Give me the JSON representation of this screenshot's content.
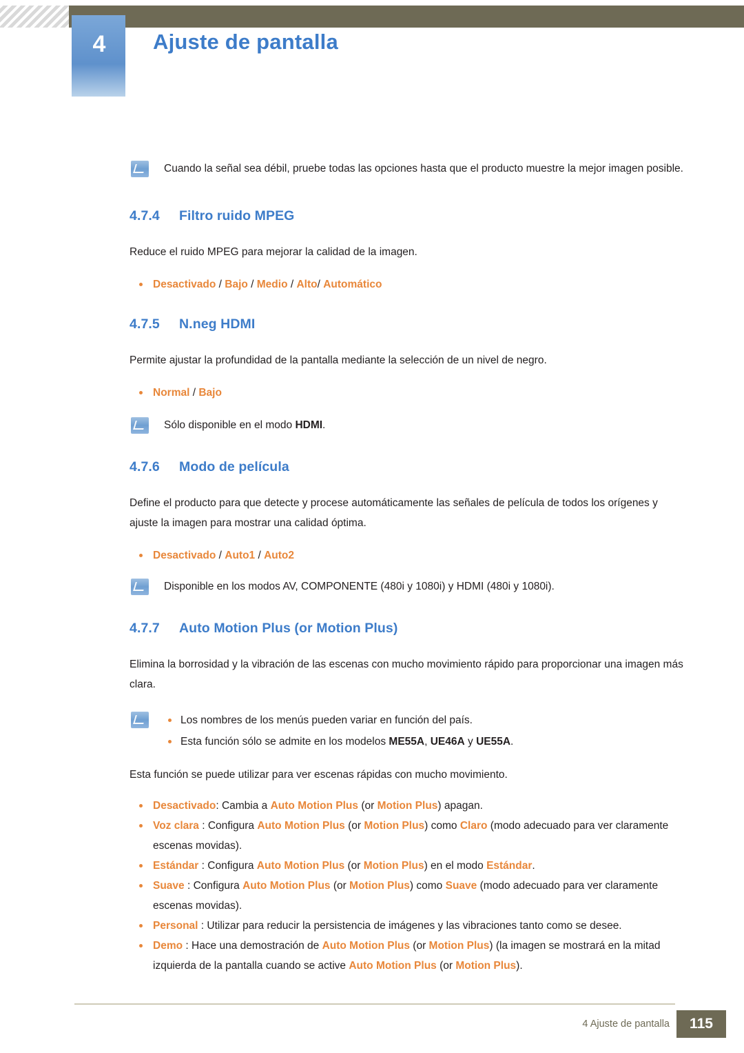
{
  "header": {
    "chapter_number": "4",
    "chapter_title": "Ajuste de pantalla"
  },
  "intro_note": {
    "text": "Cuando la señal sea débil, pruebe todas las opciones hasta que el producto muestre la mejor imagen posible."
  },
  "sections": [
    {
      "number": "4.7.4",
      "title": "Filtro ruido MPEG",
      "body": "Reduce el ruido MPEG para mejorar la calidad de la imagen.",
      "options": [
        "Desactivado",
        "Bajo",
        "Medio",
        "Alto",
        "Automático"
      ]
    },
    {
      "number": "4.7.5",
      "title": "N.neg HDMI",
      "body": "Permite ajustar la profundidad de la pantalla mediante la selección de un nivel de negro.",
      "options": [
        "Normal",
        "Bajo"
      ],
      "note_prefix": "Sólo disponible en el modo ",
      "note_keyword": "HDMI",
      "note_suffix": "."
    },
    {
      "number": "4.7.6",
      "title": "Modo de película",
      "body": "Define el producto para que detecte y procese automáticamente las señales de película de todos los orígenes y ajuste la imagen para mostrar una calidad óptima.",
      "options": [
        "Desactivado",
        "Auto1",
        "Auto2"
      ],
      "note": "Disponible en los modos AV, COMPONENTE (480i y 1080i) y HDMI (480i y 1080i)."
    },
    {
      "number": "4.7.7",
      "title": "Auto Motion Plus (or Motion Plus)",
      "body": "Elimina la borrosidad y la vibración de las escenas con mucho movimiento rápido para proporcionar una imagen más clara."
    }
  ],
  "amp_note": {
    "line1": "Los nombres de los menús pueden variar en función del país.",
    "line2_pre": "Esta función sólo se admite en los modelos ",
    "line2_models": [
      "ME55A",
      "UE46A",
      "UE55A"
    ],
    "line2_sep": ", ",
    "line2_and": " y ",
    "line2_end": "."
  },
  "amp_intro": "Esta función se puede utilizar para ver escenas rápidas con mucho movimiento.",
  "amp_options": [
    {
      "name": "Desactivado",
      "parts": [
        {
          "t": ": Cambia a ",
          "s": "plain"
        },
        {
          "t": "Auto Motion Plus",
          "s": "kw"
        },
        {
          "t": " (or ",
          "s": "plain"
        },
        {
          "t": "Motion Plus",
          "s": "kw"
        },
        {
          "t": ") apagan.",
          "s": "plain"
        }
      ]
    },
    {
      "name": "Voz clara",
      "parts": [
        {
          "t": " : Configura ",
          "s": "plain"
        },
        {
          "t": "Auto Motion Plus",
          "s": "kw"
        },
        {
          "t": " (or ",
          "s": "plain"
        },
        {
          "t": "Motion Plus",
          "s": "kw"
        },
        {
          "t": ") como ",
          "s": "plain"
        },
        {
          "t": "Claro",
          "s": "kw"
        },
        {
          "t": " (modo adecuado para ver claramente escenas movidas).",
          "s": "plain"
        }
      ]
    },
    {
      "name": "Estándar",
      "parts": [
        {
          "t": " : Configura ",
          "s": "plain"
        },
        {
          "t": "Auto Motion Plus",
          "s": "kw"
        },
        {
          "t": " (or ",
          "s": "plain"
        },
        {
          "t": "Motion Plus",
          "s": "kw"
        },
        {
          "t": ") en el modo ",
          "s": "plain"
        },
        {
          "t": "Estándar",
          "s": "kw"
        },
        {
          "t": ".",
          "s": "plain"
        }
      ]
    },
    {
      "name": "Suave",
      "parts": [
        {
          "t": " : Configura ",
          "s": "plain"
        },
        {
          "t": "Auto Motion Plus",
          "s": "kw"
        },
        {
          "t": " (or ",
          "s": "plain"
        },
        {
          "t": "Motion Plus",
          "s": "kw"
        },
        {
          "t": ") como ",
          "s": "plain"
        },
        {
          "t": "Suave",
          "s": "kw"
        },
        {
          "t": " (modo adecuado para ver claramente escenas movidas).",
          "s": "plain"
        }
      ]
    },
    {
      "name": "Personal",
      "parts": [
        {
          "t": " : Utilizar para reducir la persistencia de imágenes y las vibraciones tanto como se desee.",
          "s": "plain"
        }
      ]
    },
    {
      "name": "Demo",
      "parts": [
        {
          "t": " : Hace una demostración de ",
          "s": "plain"
        },
        {
          "t": "Auto Motion Plus",
          "s": "kw"
        },
        {
          "t": " (or ",
          "s": "plain"
        },
        {
          "t": "Motion Plus",
          "s": "kw"
        },
        {
          "t": ") (la imagen se mostrará en la mitad izquierda de la pantalla cuando se active ",
          "s": "plain"
        },
        {
          "t": "Auto Motion Plus",
          "s": "kw"
        },
        {
          "t": " (or ",
          "s": "plain"
        },
        {
          "t": "Motion Plus",
          "s": "kw"
        },
        {
          "t": ").",
          "s": "plain"
        }
      ]
    }
  ],
  "footer": {
    "text": "4 Ajuste de pantalla",
    "page": "115"
  },
  "colors": {
    "heading_blue": "#3d7cc9",
    "accent_orange": "#e8873a",
    "bar_olive": "#6e6a55"
  }
}
